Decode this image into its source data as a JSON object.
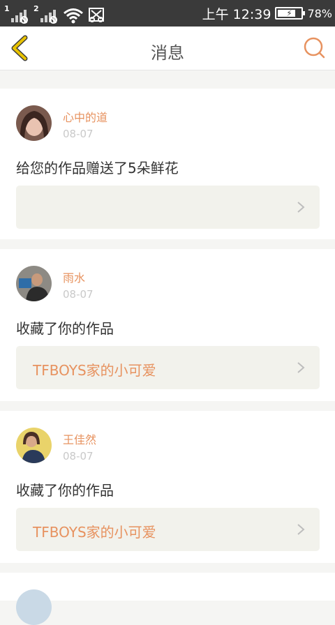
{
  "status_bar": {
    "sim1": "1",
    "sim2": "2",
    "time": "上午 12:39",
    "battery_percent": "78%",
    "battery_level": 0.78
  },
  "header": {
    "title": "消息"
  },
  "messages": [
    {
      "name": "心中的道",
      "date": "08-07",
      "text": "给您的作品赠送了5朵鲜花",
      "link": ""
    },
    {
      "name": "雨水",
      "date": "08-07",
      "text": "收藏了你的作品",
      "link": "TFBOYS家的小可爱"
    },
    {
      "name": "王佳然",
      "date": "08-07",
      "text": "收藏了你的作品",
      "link": "TFBOYS家的小可爱"
    }
  ],
  "colors": {
    "accent": "#e7925f",
    "status_bar": "#3a3a3a",
    "link_bg": "#f2f2ec",
    "back_icon": "#e8c200"
  }
}
